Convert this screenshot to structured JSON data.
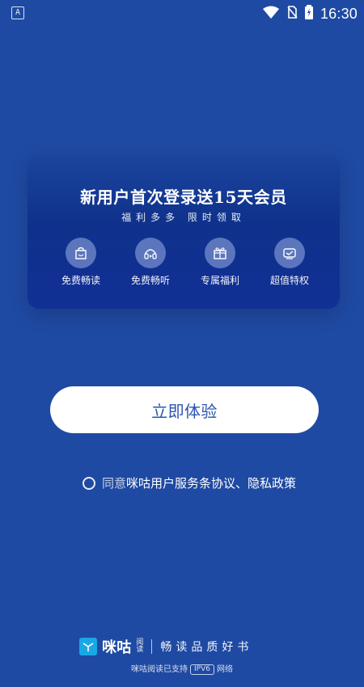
{
  "status_bar": {
    "left_icon": "A",
    "time": "16:30",
    "icons": [
      "wifi-icon",
      "no-sim-icon",
      "battery-charging-icon"
    ]
  },
  "promo": {
    "title": "新用户首次登录送15天会员",
    "subtitle": "福利多多  限时领取",
    "benefits": [
      {
        "icon": "book-icon",
        "label": "免费畅读"
      },
      {
        "icon": "headphones-icon",
        "label": "免费畅听"
      },
      {
        "icon": "gift-icon",
        "label": "专属福利"
      },
      {
        "icon": "vip-card-icon",
        "label": "超值特权"
      }
    ]
  },
  "cta": {
    "label": "立即体验"
  },
  "agreement": {
    "prefix": "同意",
    "link": "咪咕用户服务条协议、隐私政策"
  },
  "footer": {
    "brand_name": "咪咕",
    "brand_sub_1": "阅",
    "brand_sub_2": "读",
    "slogan": "畅读品质好书",
    "support_prefix": "咪咕阅读已支持",
    "ipv6": "IPV6",
    "support_suffix": "网络"
  },
  "colors": {
    "background": "#1f4aa3",
    "button_text": "#2b55b0",
    "card_bg": "#122f96"
  }
}
